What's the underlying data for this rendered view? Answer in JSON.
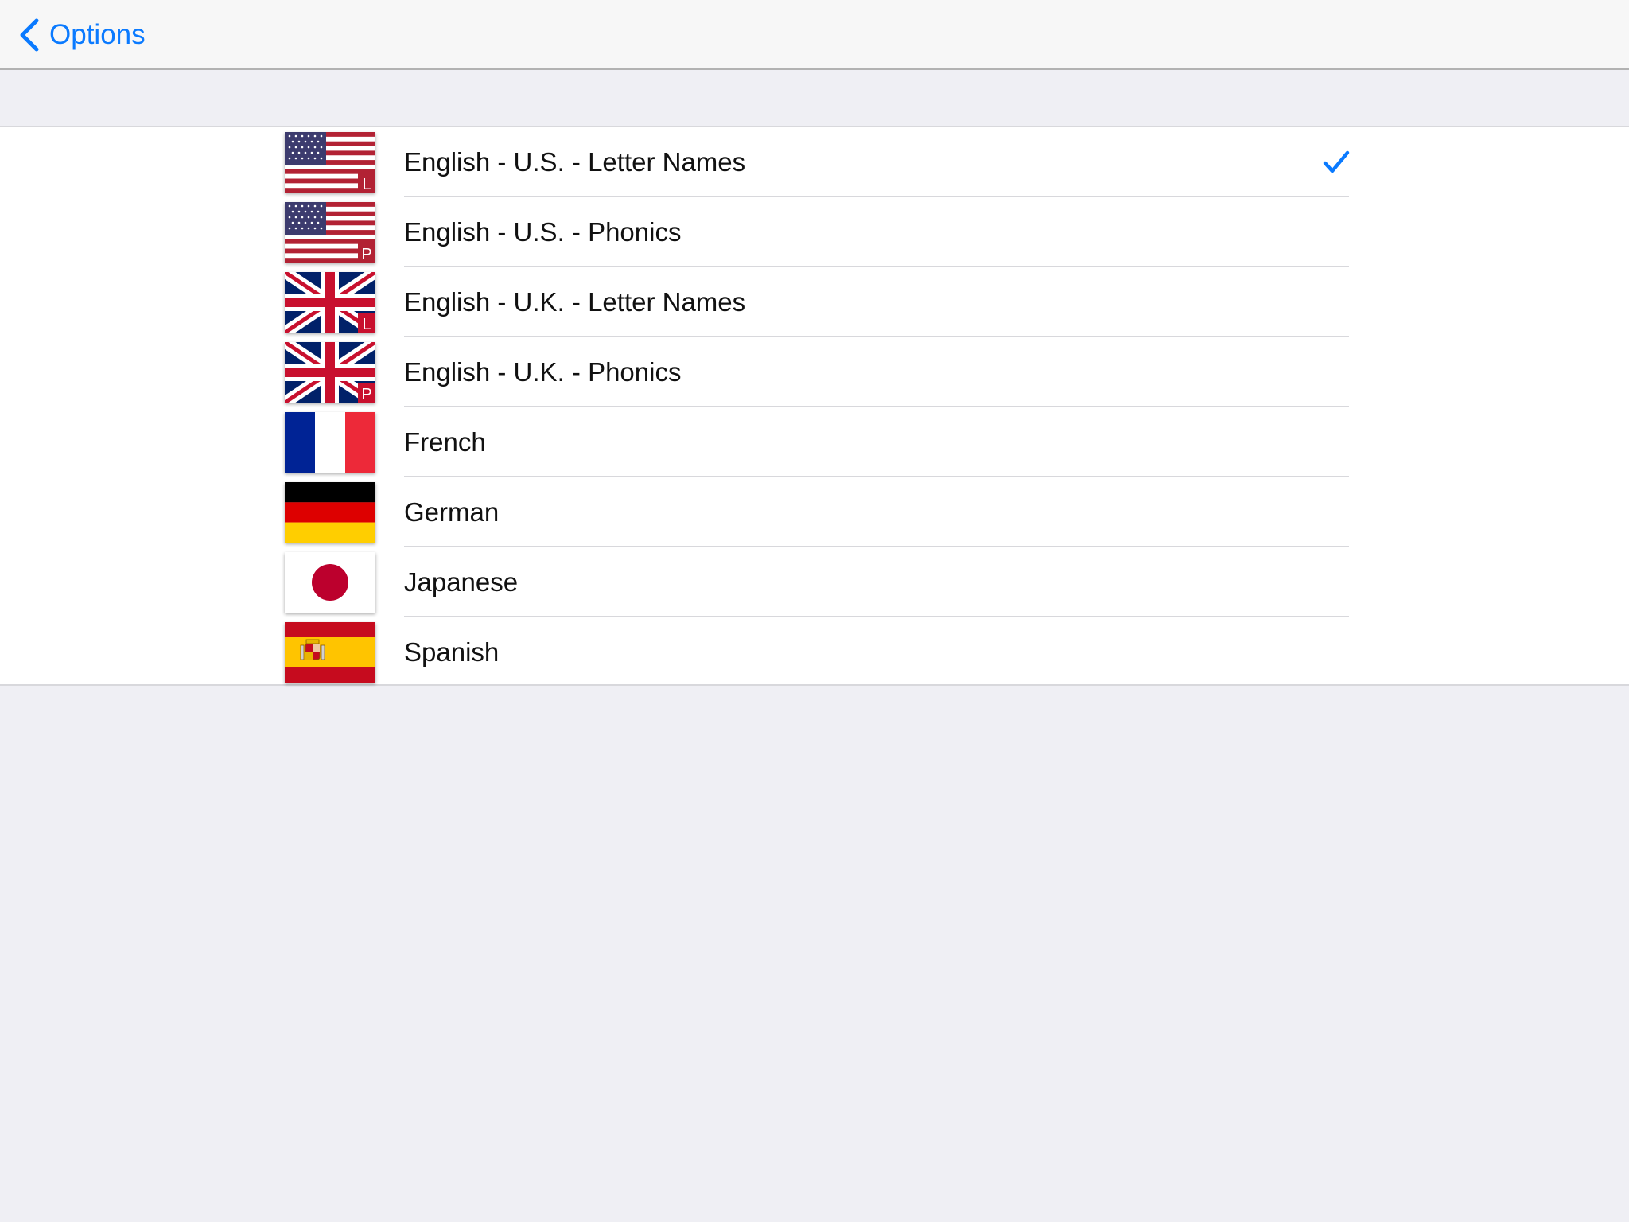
{
  "navbar": {
    "back_label": "Options",
    "back_icon": "chevron-left-icon",
    "accent_color": "#0a7aff"
  },
  "languages": {
    "selected_index": 0,
    "items": [
      {
        "label": "English - U.S. - Letter Names",
        "flag": "us-flag-icon",
        "badge": "L"
      },
      {
        "label": "English - U.S. - Phonics",
        "flag": "us-flag-icon",
        "badge": "P"
      },
      {
        "label": "English - U.K. - Letter Names",
        "flag": "uk-flag-icon",
        "badge": "L"
      },
      {
        "label": "English - U.K. - Phonics",
        "flag": "uk-flag-icon",
        "badge": "P"
      },
      {
        "label": "French",
        "flag": "france-flag-icon"
      },
      {
        "label": "German",
        "flag": "germany-flag-icon"
      },
      {
        "label": "Japanese",
        "flag": "japan-flag-icon"
      },
      {
        "label": "Spanish",
        "flag": "spain-flag-icon"
      }
    ]
  }
}
